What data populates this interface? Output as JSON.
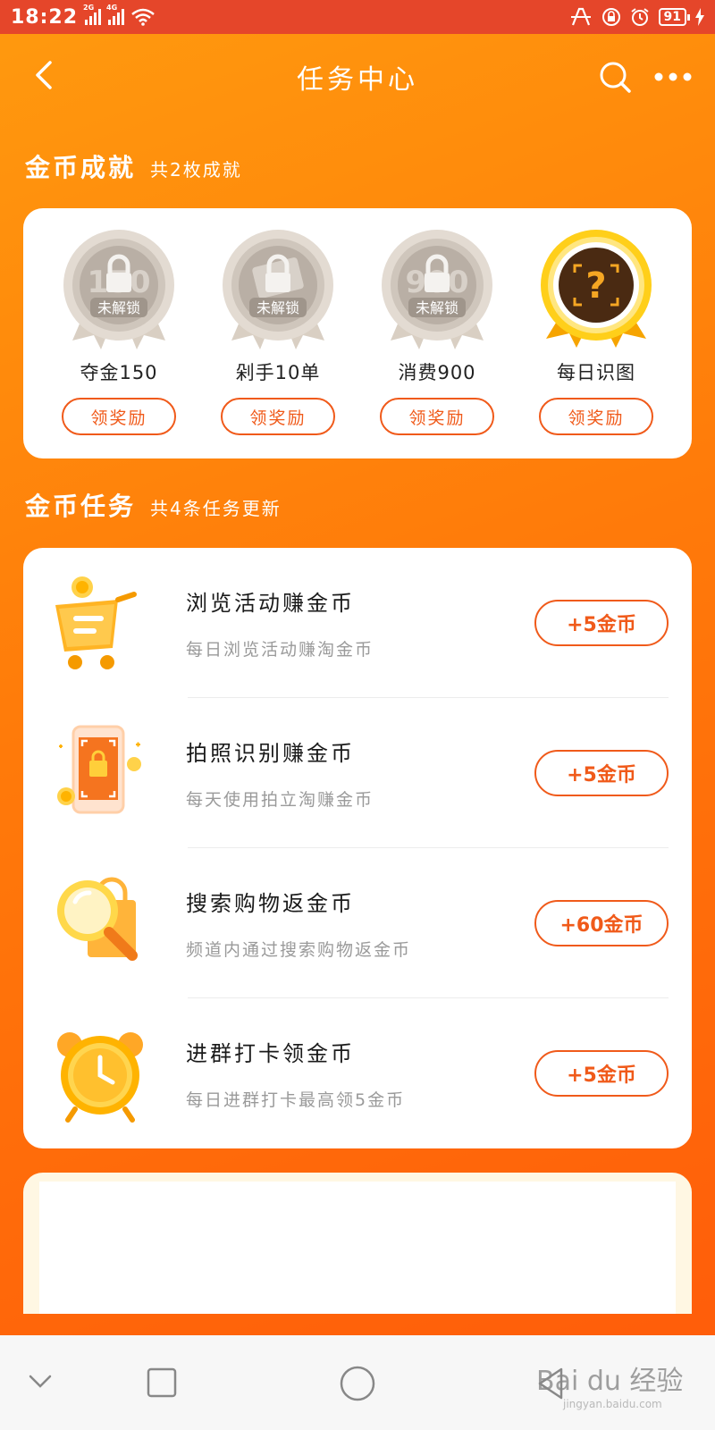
{
  "status_bar": {
    "time": "18:22",
    "net1": "2G",
    "net2": "4G",
    "battery": "91"
  },
  "nav": {
    "title": "任务中心"
  },
  "achievements": {
    "title": "金币成就",
    "subtitle": "共2枚成就",
    "items": [
      {
        "label": "夺金150",
        "button": "领奖励",
        "lock_text": "未解锁",
        "state": "locked"
      },
      {
        "label": "剁手10单",
        "button": "领奖励",
        "lock_text": "未解锁",
        "state": "locked"
      },
      {
        "label": "消费900",
        "button": "领奖励",
        "lock_text": "未解锁",
        "state": "locked"
      },
      {
        "label": "每日识图",
        "button": "领奖励",
        "state": "active"
      }
    ]
  },
  "tasks": {
    "title": "金币任务",
    "subtitle": "共4条任务更新",
    "items": [
      {
        "title": "浏览活动赚金币",
        "desc": "每日浏览活动赚淘金币",
        "reward": "+5金币",
        "icon": "shopping-cart-icon"
      },
      {
        "title": "拍照识别赚金币",
        "desc": "每天使用拍立淘赚金币",
        "reward": "+5金币",
        "icon": "phone-camera-icon"
      },
      {
        "title": "搜索购物返金币",
        "desc": "频道内通过搜索购物返金币",
        "reward": "+60金币",
        "icon": "magnifier-bag-icon"
      },
      {
        "title": "进群打卡领金币",
        "desc": "每日进群打卡最高领5金币",
        "reward": "+5金币",
        "icon": "alarm-clock-icon"
      }
    ]
  },
  "watermark": {
    "brand": "Bai du 经验",
    "url": "jingyan.baidu.com"
  },
  "colors": {
    "accent": "#f05a1a",
    "bg_top": "#ff9a0e",
    "bg_bottom": "#ff5a0a",
    "status_bar": "#e5462a"
  }
}
